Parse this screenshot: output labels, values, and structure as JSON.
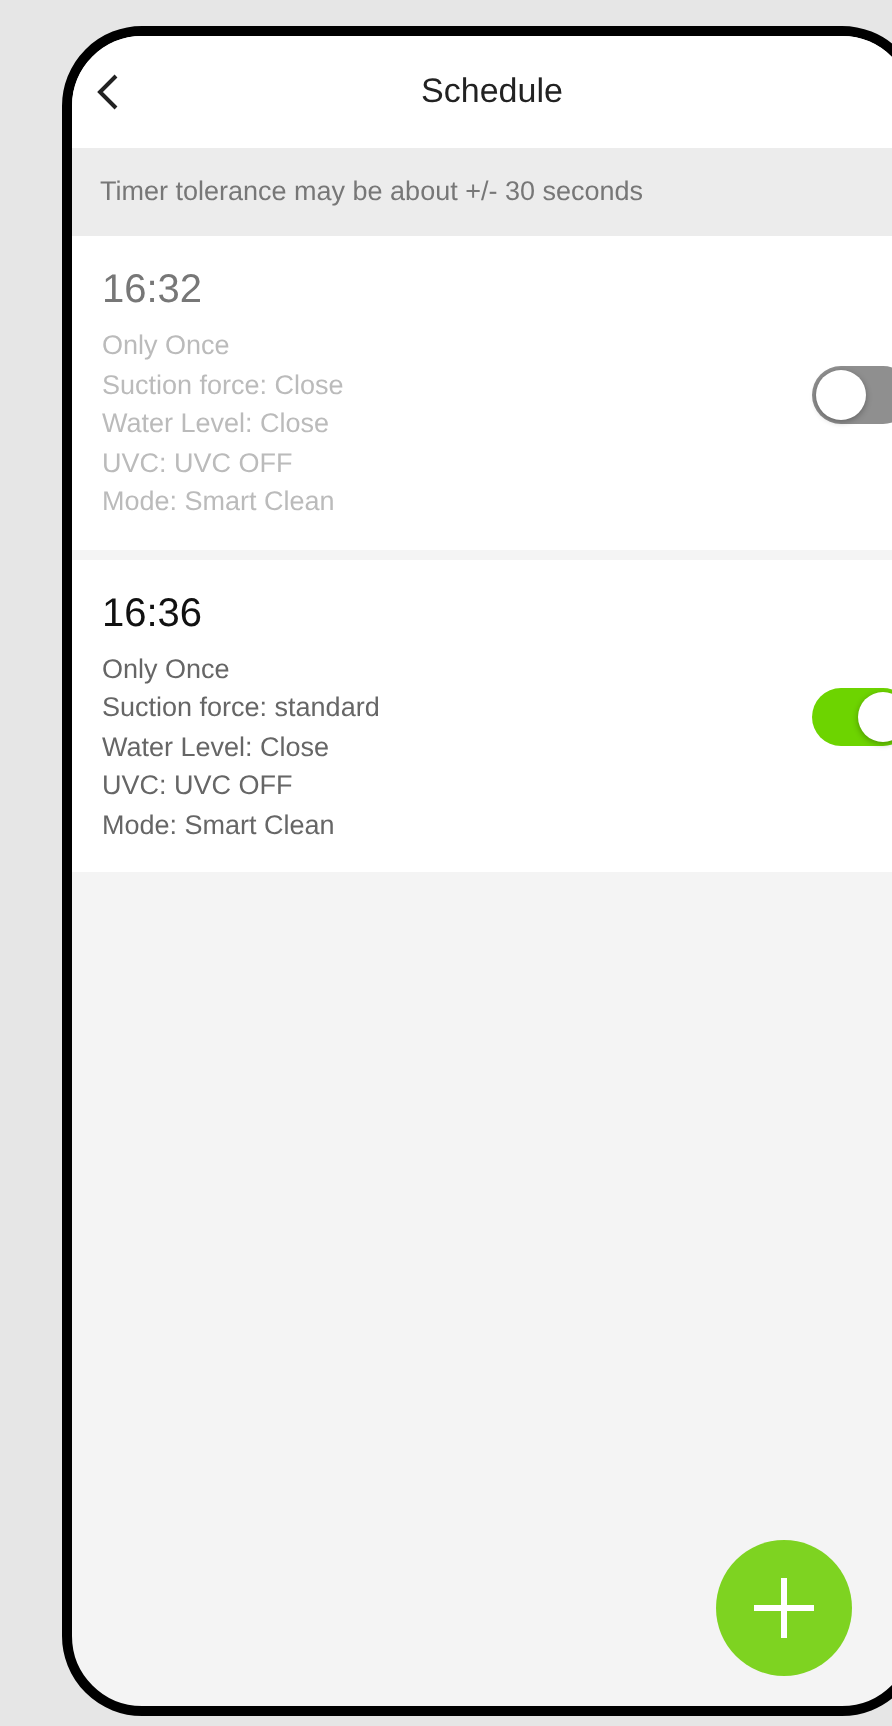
{
  "header": {
    "title": "Schedule"
  },
  "notice": "Timer tolerance may be about +/- 30 seconds",
  "schedules": [
    {
      "time": "16:32",
      "details": [
        "Only Once",
        "Suction force: Close",
        "Water Level: Close",
        "UVC: UVC OFF",
        "Mode: Smart Clean"
      ],
      "on": false
    },
    {
      "time": "16:36",
      "details": [
        "Only Once",
        "Suction force: standard",
        "Water Level: Close",
        "UVC: UVC OFF",
        "Mode: Smart Clean"
      ],
      "on": true
    }
  ]
}
